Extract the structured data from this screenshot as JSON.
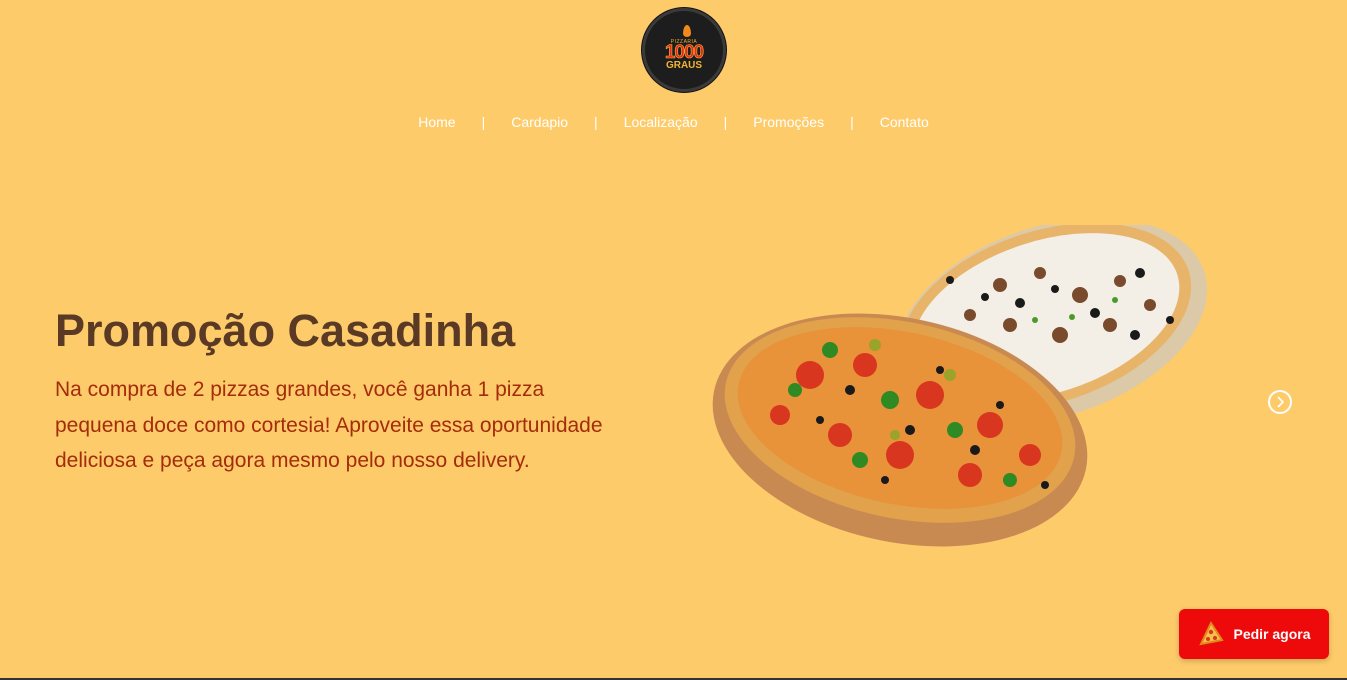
{
  "logo": {
    "small_text": "PIZZARIA",
    "big_text": "1000",
    "sub_text": "GRAUS"
  },
  "nav": {
    "items": [
      {
        "label": "Home"
      },
      {
        "label": "Cardapio"
      },
      {
        "label": "Localização"
      },
      {
        "label": "Promoções"
      },
      {
        "label": "Contato"
      }
    ],
    "separator": "|"
  },
  "hero": {
    "title": "Promoção Casadinha",
    "description": "Na compra de 2 pizzas grandes, você ganha 1 pizza pequena doce como cortesia! Aproveite essa oportunidade deliciosa e peça agora mesmo pelo nosso delivery.",
    "image_icon": "pizzas-image"
  },
  "carousel": {
    "next_icon": "chevron-right-icon"
  },
  "order_button": {
    "label": "Pedir agora",
    "icon": "pizza-slice-icon"
  },
  "colors": {
    "background": "#FECB6A",
    "title": "#5a3a24",
    "description": "#A42C0B",
    "button": "#EE0A0A",
    "nav_text": "#ffffff"
  }
}
